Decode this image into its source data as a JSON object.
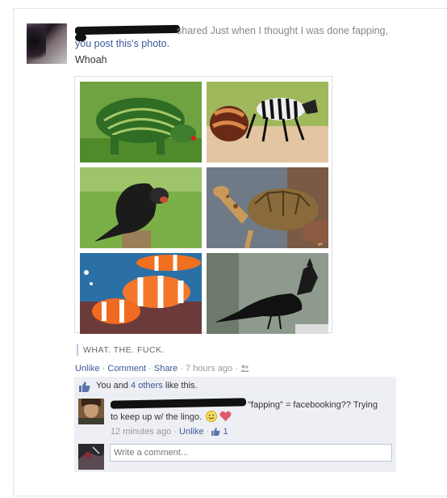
{
  "post": {
    "action_text": "shared Just when I thought I was done fapping,",
    "action_text2": "you post this's photo.",
    "caption": "Whoah",
    "photo_tiles": [
      "watermelon-rhino",
      "zebra-hermit-crab",
      "bird-monkey-face",
      "giraffe-turtle",
      "clownfish-swarm",
      "crow-horse-head"
    ],
    "quote": "WHAT. THE. FUCK.",
    "actions": {
      "unlike": "Unlike",
      "comment": "Comment",
      "share": "Share",
      "timestamp": "7 hours ago",
      "sep": "·"
    }
  },
  "likes": {
    "prefix": "You and ",
    "others": "4 others",
    "suffix": " like this."
  },
  "comment": {
    "text_line1": "\"fapping\" = facebooking?? Trying",
    "text_line2": "to keep up w/ the lingo.",
    "time": "12 minutes ago",
    "unlike": "Unlike",
    "like_count": "1"
  },
  "composer": {
    "placeholder": "Write a comment..."
  },
  "colors": {
    "link": "#3b5998",
    "ufi_bg": "#edeff4",
    "muted": "#999999"
  }
}
